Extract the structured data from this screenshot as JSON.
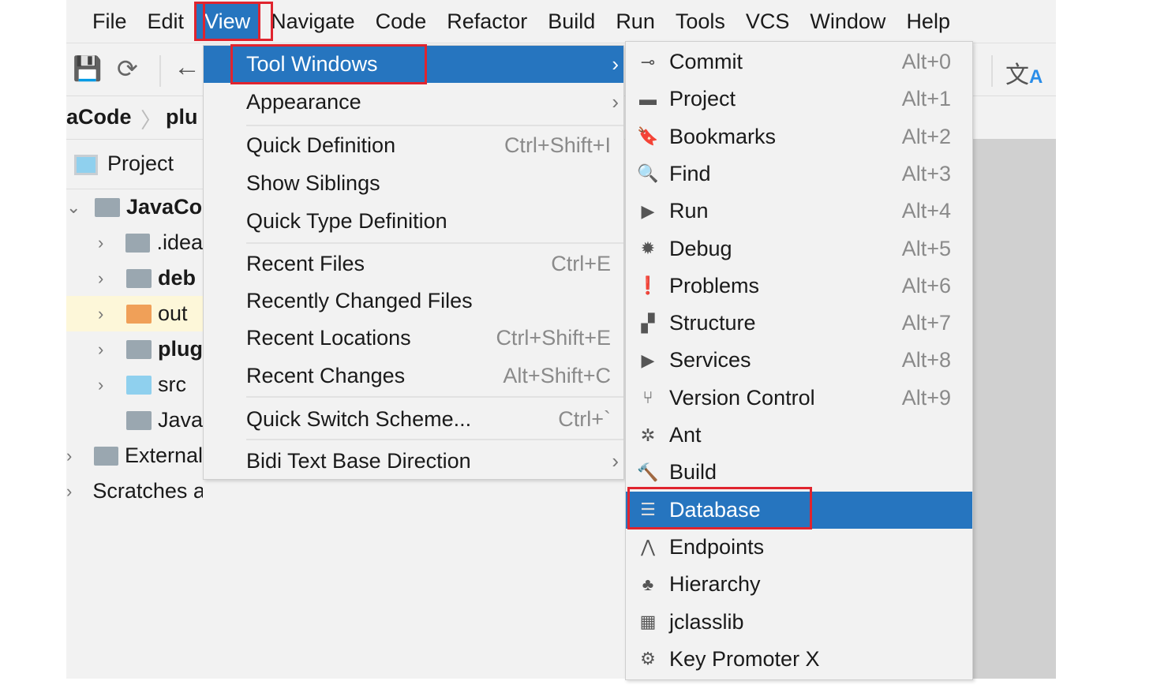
{
  "menubar": [
    "File",
    "Edit",
    "View",
    "Navigate",
    "Code",
    "Refactor",
    "Build",
    "Run",
    "Tools",
    "VCS",
    "Window",
    "Help"
  ],
  "breadcrumb": [
    "aCode",
    "plu"
  ],
  "project_panel": {
    "title": "Project",
    "tree": [
      {
        "label": "JavaCo",
        "bold": true,
        "expanded": true,
        "color": "#9aa7b0"
      },
      {
        "label": ".idea",
        "color": "#9aa7b0"
      },
      {
        "label": "deb",
        "bold": true,
        "color": "#9aa7b0"
      },
      {
        "label": "out",
        "color": "#f0a058",
        "selected": true
      },
      {
        "label": "plug",
        "bold": true,
        "color": "#9aa7b0"
      },
      {
        "label": "src",
        "color": "#8fd0ee"
      },
      {
        "label": "Java",
        "color": "#9aa7b0"
      },
      {
        "label": "External",
        "color": "#9aa7b0"
      },
      {
        "label": "Scratches and Consoles",
        "color": "#9aa7b0"
      }
    ]
  },
  "view_menu": [
    {
      "label": "Tool Windows",
      "submenu": true,
      "highlighted": true
    },
    {
      "label": "Appearance",
      "submenu": true
    },
    {
      "label": "Quick Definition",
      "shortcut": "Ctrl+Shift+I"
    },
    {
      "label": "Show Siblings"
    },
    {
      "label": "Quick Type Definition"
    },
    {
      "label": "Recent Files",
      "shortcut": "Ctrl+E"
    },
    {
      "label": "Recently Changed Files"
    },
    {
      "label": "Recent Locations",
      "shortcut": "Ctrl+Shift+E"
    },
    {
      "label": "Recent Changes",
      "shortcut": "Alt+Shift+C"
    },
    {
      "label": "Quick Switch Scheme...",
      "shortcut": "Ctrl+`"
    },
    {
      "label": "Bidi Text Base Direction",
      "submenu": true
    }
  ],
  "tool_windows": [
    {
      "label": "Commit",
      "shortcut": "Alt+0",
      "icon": "commit-icon"
    },
    {
      "label": "Project",
      "shortcut": "Alt+1",
      "icon": "folder-icon"
    },
    {
      "label": "Bookmarks",
      "shortcut": "Alt+2",
      "icon": "bookmark-icon"
    },
    {
      "label": "Find",
      "shortcut": "Alt+3",
      "icon": "search-icon"
    },
    {
      "label": "Run",
      "shortcut": "Alt+4",
      "icon": "play-icon"
    },
    {
      "label": "Debug",
      "shortcut": "Alt+5",
      "icon": "bug-icon"
    },
    {
      "label": "Problems",
      "shortcut": "Alt+6",
      "icon": "warning-icon"
    },
    {
      "label": "Structure",
      "shortcut": "Alt+7",
      "icon": "structure-icon"
    },
    {
      "label": "Services",
      "shortcut": "Alt+8",
      "icon": "services-icon"
    },
    {
      "label": "Version Control",
      "shortcut": "Alt+9",
      "icon": "branch-icon"
    },
    {
      "label": "Ant",
      "icon": "ant-icon"
    },
    {
      "label": "Build",
      "icon": "hammer-icon"
    },
    {
      "label": "Database",
      "icon": "database-icon",
      "highlighted": true
    },
    {
      "label": "Endpoints",
      "icon": "endpoints-icon"
    },
    {
      "label": "Hierarchy",
      "icon": "hierarchy-icon"
    },
    {
      "label": "jclasslib",
      "icon": "jclasslib-icon"
    },
    {
      "label": "Key Promoter X",
      "icon": "key-promoter-icon"
    }
  ],
  "colors": {
    "highlight": "#2675bf",
    "annotation": "#e0242e"
  }
}
